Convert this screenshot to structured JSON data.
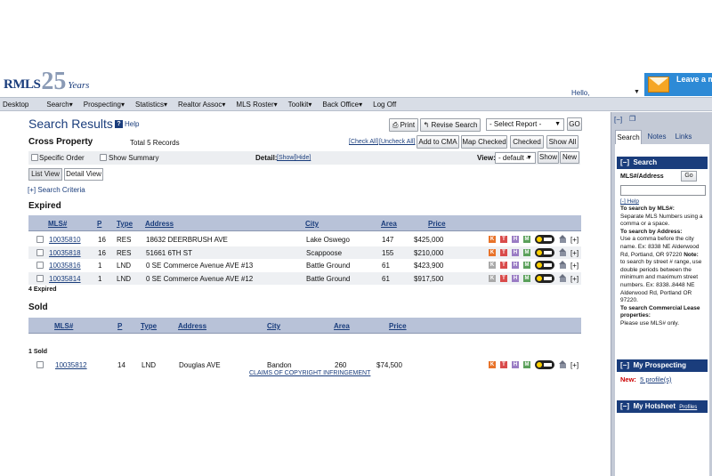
{
  "header": {
    "logo_text": "RMLS",
    "logo_years_num": "25",
    "logo_years_word": "Years",
    "hello": "Hello,",
    "leave_message": "Leave a message"
  },
  "menu": [
    "Desktop",
    "Search▾",
    "Prospecting▾",
    "Statistics▾",
    "Realtor Assoc▾",
    "MLS Roster▾",
    "Toolkit▾",
    "Back Office▾",
    "Log Off"
  ],
  "page": {
    "title": "Search Results",
    "help": "Help",
    "print": "Print",
    "revise_search": "Revise Search",
    "select_report": "- Select Report -",
    "go": "GO",
    "subtitle": "Cross Property",
    "total": "Total 5 Records",
    "check_all": "[Check All]",
    "uncheck_all": "[Uncheck All]",
    "add_to_cma": "Add to CMA",
    "map_checked": "Map Checked",
    "checked": "Checked",
    "show_all": "Show All",
    "specific_order": "Specific Order",
    "show_summary": "Show Summary",
    "detail_label": "Detail:",
    "detail_show": "[Show]",
    "detail_hide": "[Hide]",
    "view_label": "View:",
    "view_value": "- default -",
    "show": "Show",
    "new": "New",
    "tab_list": "List View",
    "tab_detail": "Detail View",
    "criteria": "[+] Search Criteria",
    "copyright": "CLAIMS OF COPYRIGHT INFRINGEMENT"
  },
  "columns": [
    "MLS#",
    "P",
    "Type",
    "Address",
    "City",
    "Area",
    "Price"
  ],
  "expired": {
    "title": "Expired",
    "footer": "4 Expired",
    "rows": [
      {
        "mls": "10035810",
        "p": "16",
        "type": "RES",
        "address": "18632 DEERBRUSH AVE",
        "city": "Lake Oswego",
        "area": "147",
        "price": "$425,000",
        "k_gray": false
      },
      {
        "mls": "10035818",
        "p": "16",
        "type": "RES",
        "address": "51661 6TH ST",
        "city": "Scappoose",
        "area": "155",
        "price": "$210,000",
        "k_gray": false
      },
      {
        "mls": "10035816",
        "p": "1",
        "type": "LND",
        "address": "0 SE Commerce Avenue AVE #13",
        "city": "Battle Ground",
        "area": "61",
        "price": "$423,900",
        "k_gray": true
      },
      {
        "mls": "10035814",
        "p": "1",
        "type": "LND",
        "address": "0 SE Commerce Avenue AVE #12",
        "city": "Battle Ground",
        "area": "61",
        "price": "$917,500",
        "k_gray": true
      }
    ]
  },
  "sold": {
    "title": "Sold",
    "footer": "1 Sold",
    "rows": [
      {
        "mls": "10035812",
        "p": "14",
        "type": "LND",
        "address": "Douglas AVE",
        "city": "Bandon",
        "area": "260",
        "price": "$74,500",
        "k_gray": false
      }
    ]
  },
  "row_icons": {
    "k": "K",
    "t": "T",
    "h": "H",
    "m": "M",
    "plus": "[+]"
  },
  "right_panel": {
    "collapse": "[−]",
    "tabs": [
      "Search",
      "Notes",
      "Links"
    ],
    "search_head": "Search",
    "mls_label": "MLS#/Address",
    "go": "Go",
    "help": "[-] Help",
    "help_text_1": "To search by MLS#:",
    "help_text_2": "Separate MLS Numbers using a comma or a space.",
    "help_text_3": "To search by Address:",
    "help_text_4": "Use a comma before the city name. Ex: 8338 NE Alderwood Rd, Portland, OR 97220",
    "help_note": "Note:",
    "help_text_5": "to search by street # range, use double periods between the minimum and maximum street numbers. Ex: 8338..8448 NE Alderwood Rd, Portland OR 97220.",
    "help_text_6": "To search Commercial Lease properties:",
    "help_text_7": "Please use MLS# only.",
    "prospecting_head": "My Prospecting",
    "profiles_link": "Profiles",
    "new_label": "New:",
    "new_value": "5 profile(s)",
    "hotsheet_head": "My Hotsheet",
    "hotsheet_link": "Profiles"
  }
}
